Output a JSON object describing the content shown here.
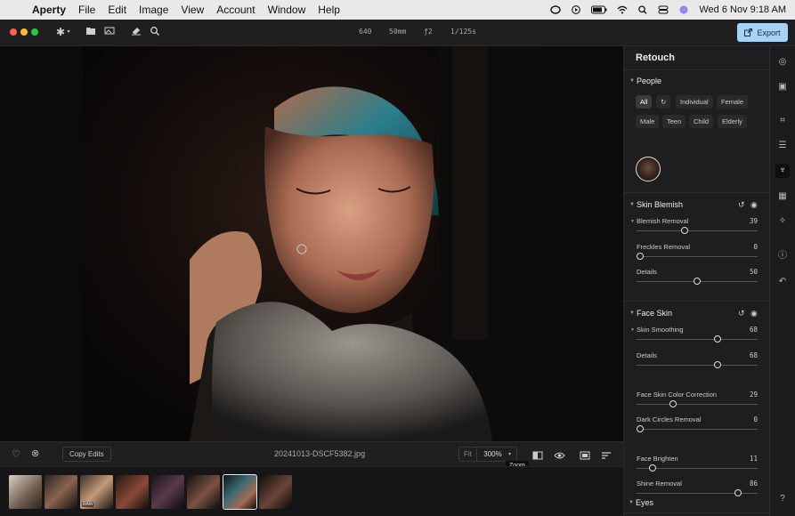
{
  "menubar": {
    "app": "Aperty",
    "items": [
      "File",
      "Edit",
      "Image",
      "View",
      "Account",
      "Window",
      "Help"
    ],
    "datetime": "Wed 6 Nov  9:18 AM"
  },
  "toolbar": {
    "exif": {
      "iso": "640",
      "focal": "50mm",
      "aperture": "ƒ2",
      "shutter": "1/125s"
    },
    "export_label": "Export"
  },
  "bottombar": {
    "copy_edits": "Copy Edits",
    "filename": "20241013-DSCF5382.jpg",
    "fit": "Fit",
    "zoom": "300%",
    "tooltip": "Zoom"
  },
  "filmstrip": {
    "raw_badge": "RAW",
    "selected_index": 6
  },
  "panel": {
    "title": "Retouch",
    "people": {
      "title": "People",
      "chips": [
        "All",
        "Individual",
        "Female",
        "Male",
        "Teen",
        "Child",
        "Elderly"
      ]
    },
    "skin_blemish": {
      "title": "Skin Blemish",
      "sliders": [
        {
          "label": "Blemish Removal",
          "value": "39",
          "fraction": 0.39
        },
        {
          "label": "Freckles Removal",
          "value": "0",
          "fraction": 0.0
        },
        {
          "label": "Details",
          "value": "50",
          "fraction": 0.5
        }
      ]
    },
    "face_skin": {
      "title": "Face Skin",
      "sliders": [
        {
          "label": "Skin Smoothing",
          "value": "68",
          "fraction": 0.68
        },
        {
          "label": "Details",
          "value": "68",
          "fraction": 0.68
        },
        {
          "label": "Face Skin Color Correction",
          "value": "29",
          "fraction": 0.29
        },
        {
          "label": "Dark Circles Removal",
          "value": "0",
          "fraction": 0.0
        },
        {
          "label": "Face Brighten",
          "value": "11",
          "fraction": 0.11
        },
        {
          "label": "Shine Removal",
          "value": "86",
          "fraction": 0.86
        }
      ]
    },
    "eyes": {
      "title": "Eyes"
    }
  },
  "colors": {
    "accent": "#a8d2f3",
    "panel_bg": "#1e1e20"
  }
}
